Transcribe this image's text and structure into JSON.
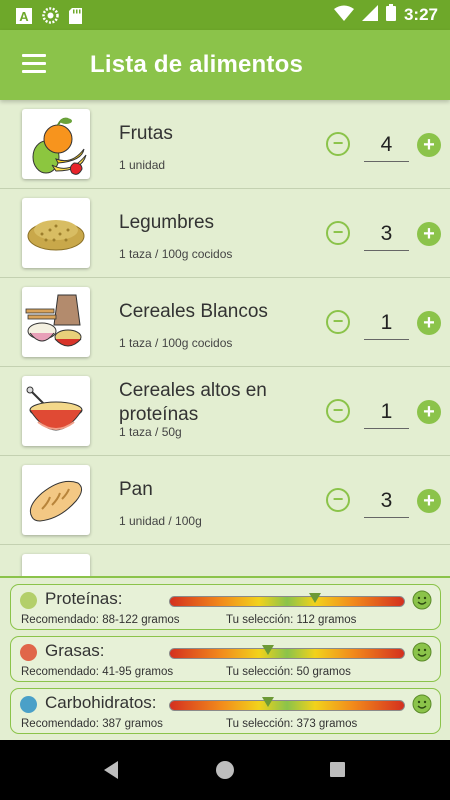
{
  "status_bar": {
    "time": "3:27",
    "left_icons": [
      "notification-a-icon",
      "sync-icon",
      "sd-card-icon"
    ],
    "right_icons": [
      "wifi-icon",
      "signal-icon",
      "battery-icon"
    ]
  },
  "app_bar": {
    "menu_icon": "hamburger-menu-icon",
    "title": "Lista de alimentos"
  },
  "foods": [
    {
      "name": "Frutas",
      "portion": "1 unidad",
      "quantity": "4",
      "icon": "fruits-icon"
    },
    {
      "name": "Legumbres",
      "portion": "1 taza / 100g cocidos",
      "quantity": "3",
      "icon": "legumes-icon"
    },
    {
      "name": "Cereales Blancos",
      "portion": "1 taza / 100g cocidos",
      "quantity": "1",
      "icon": "white-cereals-icon"
    },
    {
      "name": "Cereales altos en proteínas",
      "portion": "1 taza / 50g",
      "quantity": "1",
      "icon": "protein-cereals-icon"
    },
    {
      "name": "Pan",
      "portion": "1 unidad / 100g",
      "quantity": "3",
      "icon": "bread-icon"
    }
  ],
  "controls": {
    "minus_symbol": "−",
    "plus_symbol": "+"
  },
  "macros": [
    {
      "label": "Proteínas:",
      "recommended": "Recomendado: 88-122 gramos",
      "selection": "Tu selección: 112 gramos",
      "level": 0.62,
      "icon": "protein-icon",
      "icon_color": "#b3cf6a",
      "status_icon": "smiley-face-icon"
    },
    {
      "label": "Grasas:",
      "recommended": "Recomendado: 41-95 gramos",
      "selection": "Tu selección: 50 gramos",
      "level": 0.42,
      "icon": "fat-icon",
      "icon_color": "#e0664a",
      "status_icon": "smiley-face-icon"
    },
    {
      "label": "Carbohidratos:",
      "recommended": "Recomendado: 387 gramos",
      "selection": "Tu selección: 373 gramos",
      "level": 0.42,
      "icon": "carbs-icon",
      "icon_color": "#4aa0c8",
      "status_icon": "smiley-face-icon"
    }
  ],
  "colors": {
    "primary": "#8bc34a",
    "status_bar": "#6ea82a",
    "background": "#e3eed1"
  },
  "nav": {
    "icons": [
      "back-icon",
      "home-icon",
      "recents-icon"
    ]
  }
}
